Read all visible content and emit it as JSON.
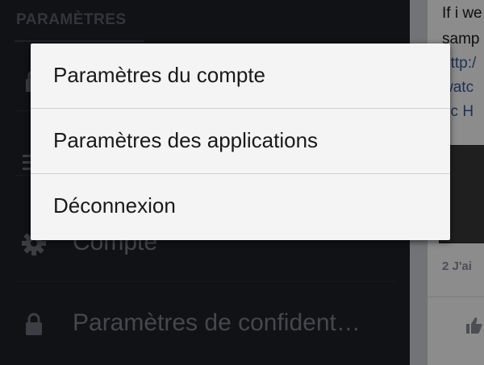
{
  "sidebar": {
    "header": "PARAMÈTRES",
    "items": [
      {
        "label": "Compte",
        "icon": "gear-icon"
      },
      {
        "label": "Paramètres de confident…",
        "icon": "lock-icon"
      }
    ]
  },
  "feed": {
    "post_lines": [
      "If i we",
      "samp",
      "http:/",
      "watc",
      "ric H"
    ],
    "likes": "2 J'ai"
  },
  "menu": {
    "items": [
      "Paramètres du compte",
      "Paramètres des applications",
      "Déconnexion"
    ]
  }
}
